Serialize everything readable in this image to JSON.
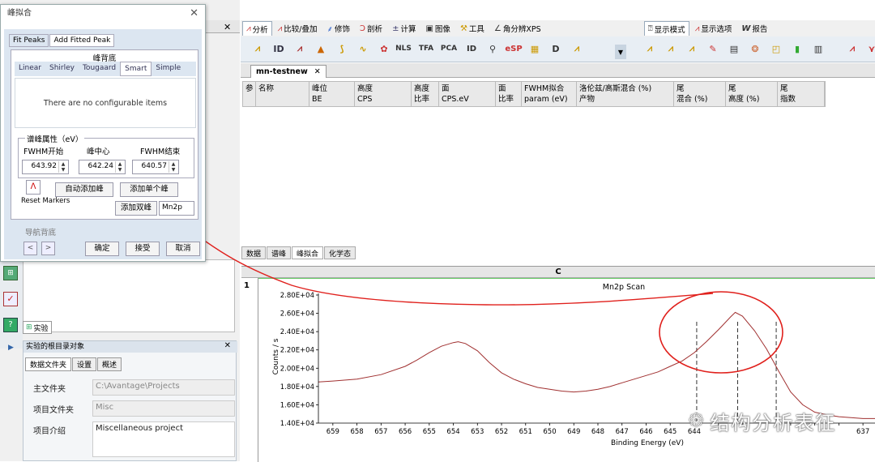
{
  "ribbon": {
    "tabs": [
      {
        "icon": "chart-analysis-icon",
        "label": "分析",
        "active": true
      },
      {
        "icon": "compare-icon",
        "label": "比较/叠加"
      },
      {
        "icon": "decorate-icon",
        "label": "修饰"
      },
      {
        "icon": "profile-icon",
        "label": "剖析"
      },
      {
        "icon": "calculate-icon",
        "label": "计算"
      },
      {
        "icon": "image-icon",
        "label": "图像"
      },
      {
        "icon": "tools-icon",
        "label": "工具"
      },
      {
        "icon": "angle-resolved-icon",
        "label": "角分辨XPS"
      },
      {
        "icon": "display-mode-icon",
        "label": "显示模式",
        "active": true
      },
      {
        "icon": "display-options-icon",
        "label": "显示选项"
      },
      {
        "icon": "report-icon",
        "label": "报告"
      }
    ],
    "toolbar_text_buttons": [
      "ID",
      "NLS",
      "TFA",
      "PCA",
      "ID",
      "eSP",
      "D"
    ]
  },
  "document": {
    "tab_label": "mn-testnew"
  },
  "peak_table": {
    "columns": [
      "参",
      "名称",
      "峰位\nBE",
      "高度\nCPS",
      "高度\n比率",
      "面\nCPS.eV",
      "面\n比率",
      "FWHM拟合\nparam (eV)",
      "洛伦兹/高斯混合 (%)\n产物",
      "尾\n混合 (%)",
      "尾\n高度 (%)",
      "尾\n指数"
    ]
  },
  "bottom_tabs": [
    "数据",
    "谱峰",
    "峰拟合",
    "化学态"
  ],
  "bottom_tab_active": 2,
  "chart_col_header": "C",
  "row_number": "1",
  "chart_data": {
    "type": "line",
    "title": "Mn2p Scan",
    "xlabel": "Binding Energy (eV)",
    "ylabel": "Counts / s",
    "xlim": [
      659.6,
      636.5
    ],
    "ylim": [
      14000,
      28000
    ],
    "x_ticks": [
      659,
      658,
      657,
      656,
      655,
      654,
      653,
      652,
      651,
      650,
      649,
      648,
      647,
      646,
      645,
      644,
      643,
      642,
      641,
      640,
      639,
      638,
      637
    ],
    "x_tick_labels": [
      "659",
      "658",
      "657",
      "656",
      "655",
      "654",
      "653",
      "652",
      "651",
      "650",
      "649",
      "648",
      "647",
      "646",
      "645",
      "644",
      "",
      "",
      "",
      "",
      "",
      "",
      "637"
    ],
    "y_ticks": [
      14000,
      16000,
      18000,
      20000,
      22000,
      24000,
      26000,
      28000
    ],
    "y_tick_labels": [
      "1.40E+04",
      "1.60E+04",
      "1.80E+04",
      "2.00E+04",
      "2.20E+04",
      "2.40E+04",
      "2.60E+04",
      "2.80E+04"
    ],
    "series": [
      {
        "color": "#a03030",
        "x": [
          659.6,
          659,
          658,
          657,
          656,
          655.5,
          655,
          654.5,
          654,
          653.8,
          653.5,
          653,
          652.5,
          652,
          651.5,
          651,
          650.5,
          650,
          649.5,
          649,
          648.5,
          648,
          647.5,
          647,
          646.5,
          646,
          645.5,
          645,
          644.5,
          644,
          643.5,
          643,
          642.5,
          642.3,
          642,
          641.5,
          641,
          640.5,
          640,
          639.5,
          639,
          638.5,
          638,
          637.5,
          637,
          636.5
        ],
        "y": [
          18500,
          18600,
          18800,
          19300,
          20200,
          20900,
          21700,
          22400,
          22800,
          22900,
          22700,
          21900,
          20600,
          19500,
          18800,
          18300,
          17900,
          17700,
          17500,
          17400,
          17500,
          17700,
          18000,
          18400,
          18800,
          19200,
          19600,
          20200,
          20800,
          21700,
          22900,
          24200,
          25600,
          26100,
          25700,
          24100,
          22100,
          19700,
          17400,
          16000,
          15200,
          14900,
          14700,
          14600,
          14500,
          14500
        ]
      }
    ],
    "markers_x": [
      643.9,
      642.2,
      640.6
    ],
    "grid": false
  },
  "dialog": {
    "title": "峰拟合",
    "tabs": [
      "Fit Peaks",
      "Add Fitted Peak"
    ],
    "active_tab": 1,
    "group_title": "峰背底",
    "background_tabs": [
      "Linear",
      "Shirley",
      "Tougaard",
      "Smart",
      "Simple"
    ],
    "background_active": 3,
    "no_config_text": "There are no configurable items",
    "props_title": "谱峰属性（eV）",
    "fwhm_start_label": "FWHM开始",
    "center_label": "峰中心",
    "fwhm_end_label": "FWHM结束",
    "fwhm_start_value": "643.92",
    "center_value": "642.24",
    "fwhm_end_value": "640.57",
    "reset_label": "Reset Markers",
    "auto_add_label": "自动添加峰",
    "add_single_label": "添加单个峰",
    "add_double_label": "添加双峰",
    "peak_name_value": "Mn2p",
    "nav_label": "导航背底",
    "ok_label": "确定",
    "accept_label": "接受",
    "cancel_label": "取消"
  },
  "experiment": {
    "tab_label": "实验",
    "panel_title": "实验的根目录对象",
    "tabs": [
      "数据文件夹",
      "设置",
      "概述"
    ],
    "main_folder_label": "主文件夹",
    "main_folder_value": "C:\\Avantage\\Projects",
    "project_folder_label": "项目文件夹",
    "project_folder_value": "Misc",
    "project_intro_label": "项目介绍",
    "project_intro_value": "Miscellaneous project"
  },
  "watermark": "结构分析表征",
  "annotation_color": "#e0201c"
}
